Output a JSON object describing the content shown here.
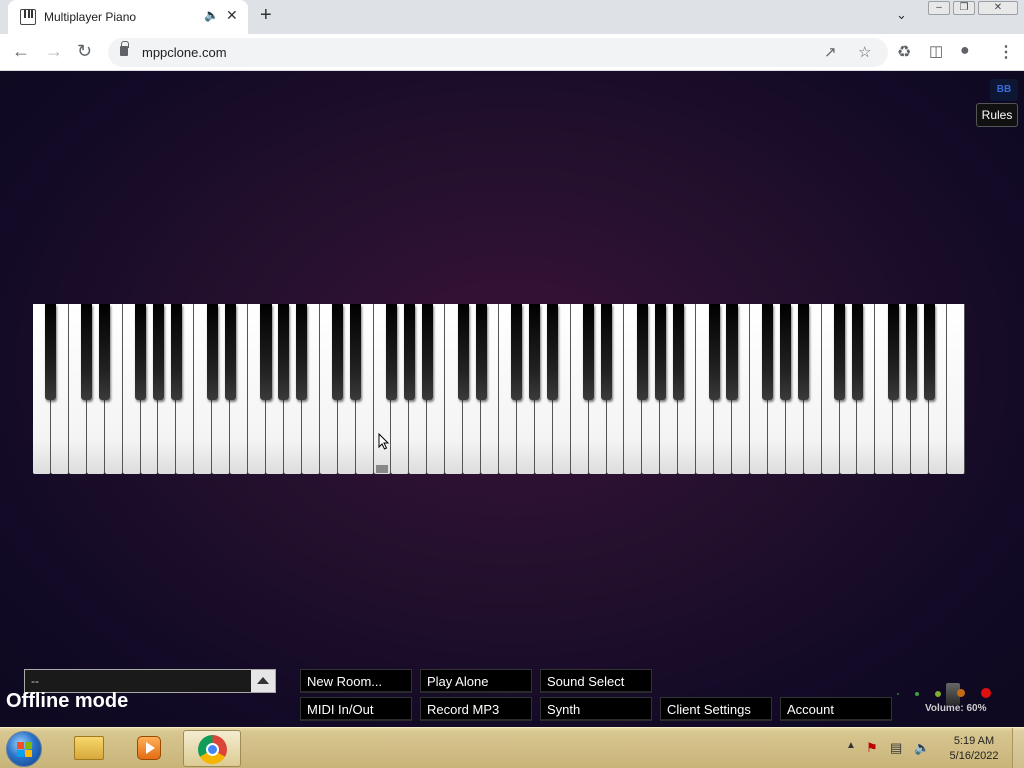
{
  "browser": {
    "tab_title": "Multiplayer Piano",
    "url": "mppclone.com",
    "icons": [
      "piano-favicon",
      "audio-icon",
      "close-icon",
      "new-tab-icon",
      "back-icon",
      "forward-icon",
      "reload-icon",
      "lock-icon",
      "share-icon",
      "star-icon",
      "extensions-icon",
      "side-panel-icon",
      "profile-icon",
      "menu-icon"
    ]
  },
  "page": {
    "top_icon": "BB",
    "rules_label": "Rules",
    "room_select_value": "--",
    "offline_label": "Offline mode",
    "buttons_row1": [
      "New Room...",
      "Play Alone",
      "Sound Select"
    ],
    "buttons_row2": [
      "MIDI In/Out",
      "Record MP3",
      "Synth",
      "Client Settings",
      "Account"
    ],
    "volume_label": "Volume: 60%",
    "volume_level": 0.6
  },
  "piano": {
    "white_keys": 52,
    "black_key_pattern": "A0-C8 88-key layout"
  },
  "taskbar": {
    "apps": [
      "windows-start",
      "file-explorer",
      "media-player",
      "chrome"
    ],
    "time": "5:19 AM",
    "date": "5/16/2022"
  },
  "colors": {
    "page_bg": "#1a0a2a",
    "button_bg": "#000000",
    "taskbar_bg": "#d8c690"
  }
}
